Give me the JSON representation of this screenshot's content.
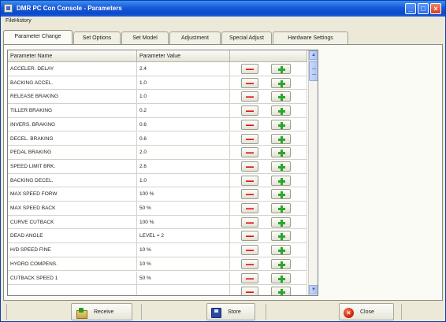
{
  "window": {
    "title": "DMR PC Con Console - Parameters",
    "minimize_glyph": "_",
    "maximize_glyph": "□",
    "close_glyph": "×"
  },
  "menu": [
    "File",
    "History"
  ],
  "tabs": [
    {
      "label": "Parameter Change",
      "active": true
    },
    {
      "label": "Set Options",
      "active": false
    },
    {
      "label": "Set Model",
      "active": false
    },
    {
      "label": "Adjustment",
      "active": false
    },
    {
      "label": "Special Adjust",
      "active": false
    },
    {
      "label": "Hardware Settings",
      "active": false
    }
  ],
  "grid": {
    "columns": [
      "Parameter Name",
      "Parameter Value",
      ""
    ],
    "rows": [
      {
        "name": "ACCELER. DELAY",
        "value": "2.4"
      },
      {
        "name": "BACKING ACCEL.",
        "value": "1.0"
      },
      {
        "name": "RELEASE BRAKING",
        "value": "1.0"
      },
      {
        "name": "TILLER BRAKING",
        "value": "0.2"
      },
      {
        "name": "INVERS. BRAKING",
        "value": "0.6"
      },
      {
        "name": "DECEL. BRAKING",
        "value": "0.6"
      },
      {
        "name": "PEDAL BRAKING",
        "value": "2.0"
      },
      {
        "name": "SPEED LIMIT BRK.",
        "value": "2.6"
      },
      {
        "name": "BACKING DECEL.",
        "value": "1.0"
      },
      {
        "name": "MAX SPEED FORW",
        "value": "100 %"
      },
      {
        "name": "MAX SPEED BACK",
        "value": "50 %"
      },
      {
        "name": "CURVE CUTBACK",
        "value": "100 %"
      },
      {
        "name": "DEAD ANGLE",
        "value": "LEVEL = 2"
      },
      {
        "name": "H/D SPEED FINE",
        "value": "10 %"
      },
      {
        "name": "HYDRO COMPENS.",
        "value": "10 %"
      },
      {
        "name": "CUTBACK SPEED 1",
        "value": "50 %"
      },
      {
        "name": "",
        "value": ""
      }
    ]
  },
  "scrollbar": {
    "up_glyph": "▲",
    "down_glyph": "▼"
  },
  "footer": {
    "receive_label": "Receive",
    "save_label": "Store",
    "close_label": "Close",
    "close_glyph": "×"
  }
}
